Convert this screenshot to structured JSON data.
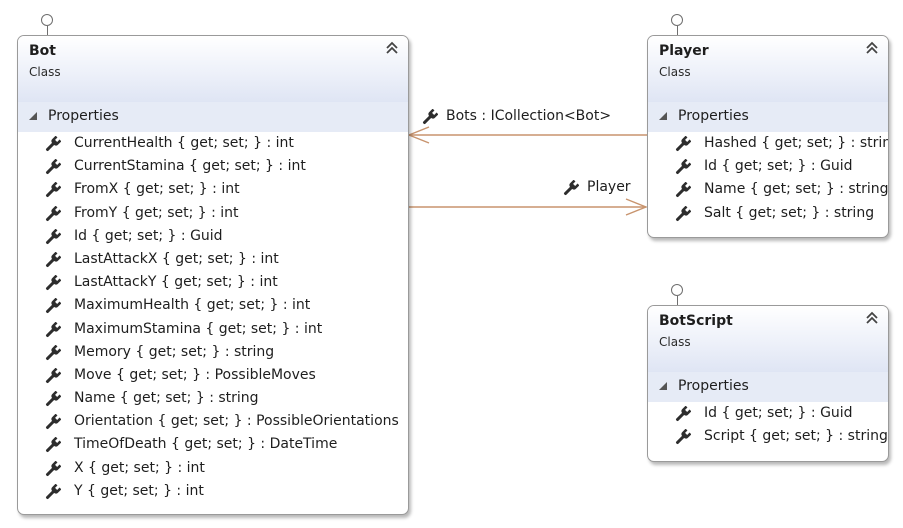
{
  "diagram": {
    "colors": {
      "connector": "#c8946e",
      "header_gradient_bottom": "#dfe5f4",
      "section_background": "#e6ebf6",
      "border": "#9a9a9a"
    },
    "classes": {
      "bot": {
        "name": "Bot",
        "stereotype": "Class",
        "section_label": "Properties",
        "members": [
          "CurrentHealth { get; set; } : int",
          "CurrentStamina { get; set; } : int",
          "FromX { get; set; } : int",
          "FromY { get; set; } : int",
          "Id { get; set; } : Guid",
          "LastAttackX { get; set; } : int",
          "LastAttackY { get; set; } : int",
          "MaximumHealth { get; set; } : int",
          "MaximumStamina { get; set; } : int",
          "Memory { get; set; } : string",
          "Move { get; set; } : PossibleMoves",
          "Name { get; set; } : string",
          "Orientation { get; set; } : PossibleOrientations",
          "TimeOfDeath { get; set; } : DateTime",
          "X { get; set; } : int",
          "Y { get; set; } : int"
        ]
      },
      "player": {
        "name": "Player",
        "stereotype": "Class",
        "section_label": "Properties",
        "members": [
          "Hashed { get; set; } : string",
          "Id { get; set; } : Guid",
          "Name { get; set; } : string",
          "Salt { get; set; } : string"
        ]
      },
      "botscript": {
        "name": "BotScript",
        "stereotype": "Class",
        "section_label": "Properties",
        "members": [
          "Id { get; set; } : Guid",
          "Script { get; set; } : string"
        ]
      }
    },
    "associations": {
      "bots": {
        "label": "Bots : ICollection<Bot>",
        "icon": "wrench-icon"
      },
      "player": {
        "label": "Player",
        "icon": "wrench-icon"
      }
    }
  }
}
